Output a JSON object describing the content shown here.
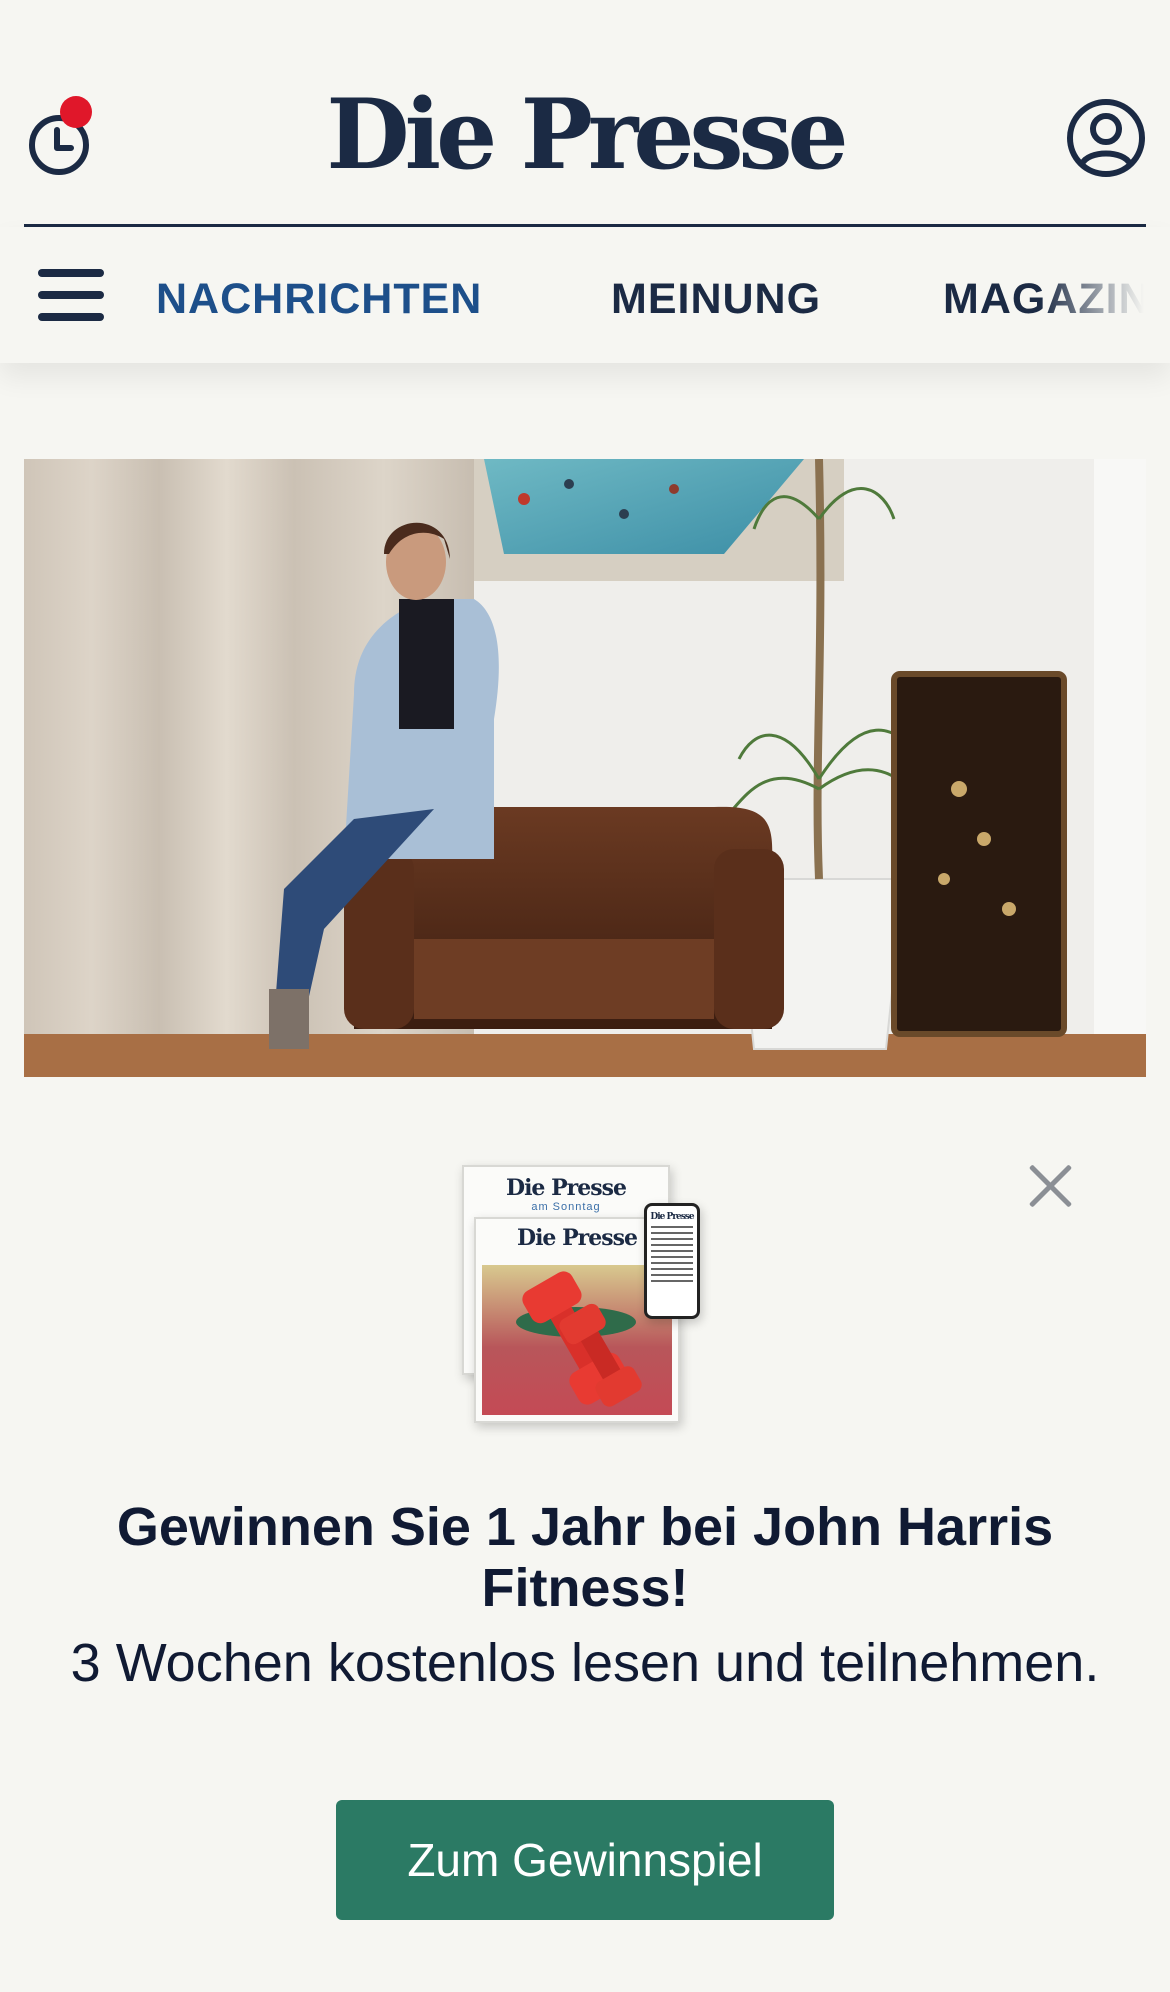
{
  "header": {
    "brand": "Die Presse",
    "history_icon": "clock-history-icon",
    "user_icon": "user-account-icon",
    "accent_color": "#e0172a"
  },
  "nav": {
    "menu_icon": "hamburger-menu-icon",
    "items": [
      {
        "label": "NACHRICHTEN",
        "active": true
      },
      {
        "label": "MEINUNG",
        "active": false
      },
      {
        "label": "MAGAZIN",
        "active": false
      }
    ],
    "active_color": "#1d4f8a"
  },
  "article": {
    "image": "photo-woman-on-leather-armchair"
  },
  "promo": {
    "close_icon": "close-icon",
    "art": {
      "paper_back_title": "Die Presse",
      "paper_back_subtitle": "am Sonntag",
      "paper_front_title": "Die Presse",
      "phone_title": "Die Presse"
    },
    "headline": "Gewinnen Sie 1 Jahr bei John Harris Fitness!",
    "subline": "3 Wochen kostenlos lesen und teilnehmen.",
    "cta_label": "Zum Gewinnspiel",
    "cta_color": "#2b7a64"
  }
}
